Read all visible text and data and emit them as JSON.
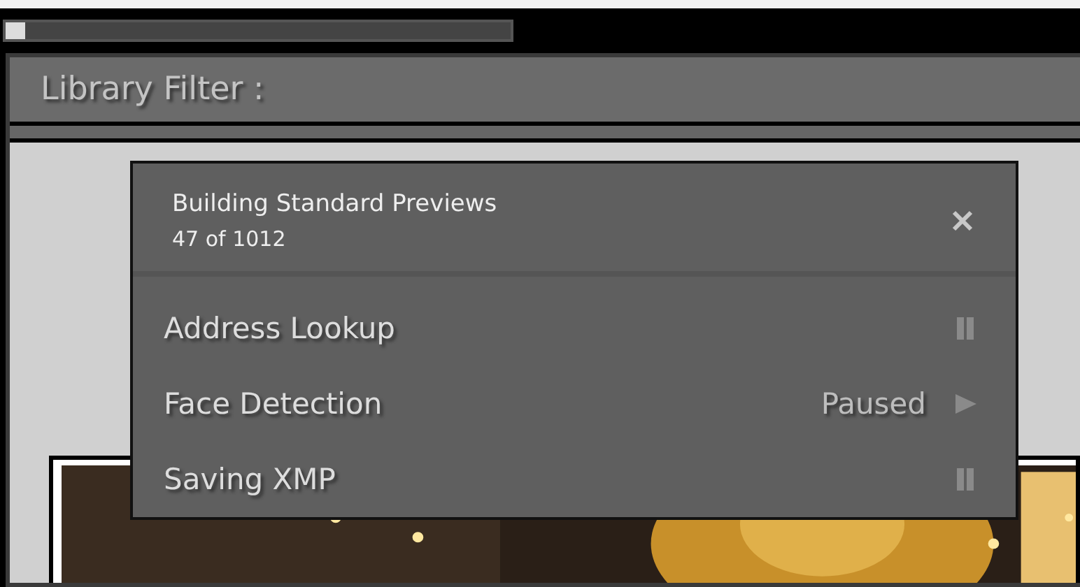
{
  "top_progress": {
    "level": 0.04
  },
  "filter_bar": {
    "title": "Library Filter :"
  },
  "activity_popover": {
    "title": "Building Standard Previews",
    "progress_text": "47 of 1012",
    "tasks": [
      {
        "name": "Address Lookup",
        "paused": false
      },
      {
        "name": "Face Detection",
        "paused": true,
        "status": "Paused"
      },
      {
        "name": "Saving XMP",
        "paused": false
      }
    ]
  }
}
